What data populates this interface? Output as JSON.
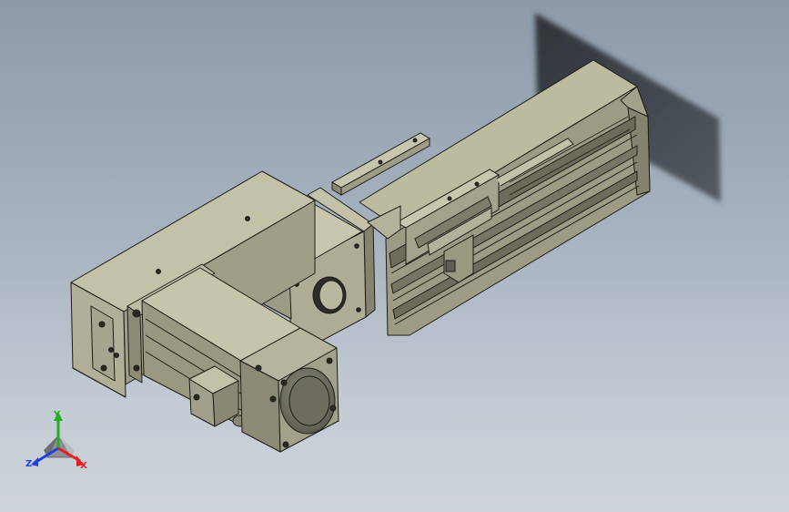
{
  "viewport": {
    "background_top": "#8c9aaa",
    "background_bottom": "#cfd4db"
  },
  "model": {
    "body_color": "#a9a78f",
    "body_dark": "#7b7a66",
    "body_light": "#c8c6ad",
    "edge_color": "#1c1c18",
    "shadow_color": "#2a2e33"
  },
  "triad": {
    "x_label": "X",
    "y_label": "Y",
    "z_label": "Z",
    "x_color": "#e02020",
    "y_color": "#20b020",
    "z_color": "#2040e0"
  }
}
